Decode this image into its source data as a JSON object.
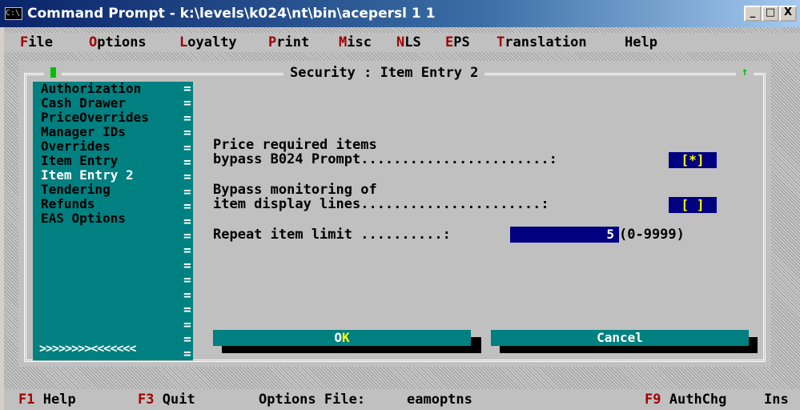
{
  "window": {
    "title": "Command Prompt - k:\\levels\\k024\\nt\\bin\\acepersl 1 1",
    "icon_label": "C:\\",
    "buttons": {
      "minimize": "_",
      "maximize": "□",
      "close": "X"
    }
  },
  "menubar": {
    "items": [
      {
        "hotkey": "F",
        "rest": "ile"
      },
      {
        "hotkey": "O",
        "rest": "ptions"
      },
      {
        "hotkey": "L",
        "rest": "oyalty"
      },
      {
        "hotkey": "P",
        "rest": "rint"
      },
      {
        "hotkey": "M",
        "rest": "isc"
      },
      {
        "hotkey": "N",
        "rest": "LS"
      },
      {
        "hotkey": "E",
        "rest": "PS"
      },
      {
        "hotkey": "T",
        "rest": "ranslation"
      },
      {
        "hotkey": "",
        "rest": "Help"
      }
    ]
  },
  "dialog": {
    "title": "Security : Item Entry 2",
    "left_marker": "[ ]",
    "right_marker": "[↑]"
  },
  "sidebar": {
    "items": [
      {
        "label": "Authorization"
      },
      {
        "label": "Cash Drawer"
      },
      {
        "label": "PriceOverrides"
      },
      {
        "label": "Manager IDs"
      },
      {
        "label": "Overrides"
      },
      {
        "label": "Item Entry"
      },
      {
        "label": "Item Entry 2"
      },
      {
        "label": "Tendering"
      },
      {
        "label": "Refunds"
      },
      {
        "label": "EAS Options"
      }
    ],
    "selected": "Item Entry 2",
    "scroll_indicator": ">>>>>>>><<<<<<<"
  },
  "form": {
    "price_required": {
      "line1": "Price required items",
      "line2": "bypass B024 Prompt.......................:",
      "value": "[*]"
    },
    "bypass_monitoring": {
      "line1": "Bypass monitoring of",
      "line2": "item display lines......................:",
      "value": "[ ]"
    },
    "repeat_limit": {
      "label": "Repeat item limit ..........:",
      "value": "5",
      "range": "(0-9999)"
    }
  },
  "buttons": {
    "ok": {
      "hotkey": "O",
      "rest": "K"
    },
    "cancel": {
      "label": "Cancel"
    }
  },
  "statusbar": {
    "help": {
      "key": "F1",
      "label": "Help"
    },
    "quit": {
      "key": "F3",
      "label": "Quit"
    },
    "options_file_label": "Options File:",
    "options_file_value": "eamoptns",
    "authchg": {
      "key": "F9",
      "label": "AuthChg"
    },
    "mode": "Ins"
  },
  "colors": {
    "console_bg": "#c0c0c0",
    "sidebar_bg": "#008080",
    "field_bg": "#000080",
    "hotkey_red": "#a00000",
    "check_yellow": "#ffff00"
  }
}
